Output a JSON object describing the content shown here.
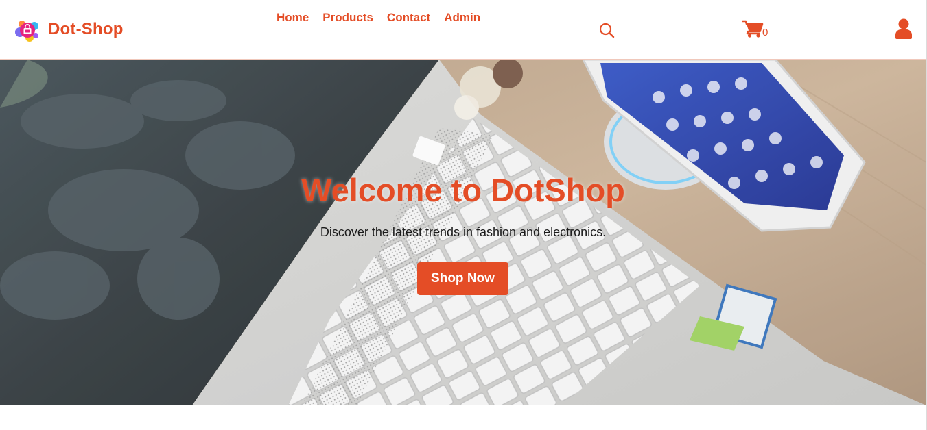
{
  "brand": {
    "name": "Dot-Shop",
    "icon": "shopping-bag-bubbles-icon",
    "color": "#e44d26"
  },
  "nav": {
    "items": [
      {
        "label": "Home"
      },
      {
        "label": "Products"
      },
      {
        "label": "Contact"
      },
      {
        "label": "Admin"
      }
    ]
  },
  "header": {
    "search_icon": "search-icon",
    "cart_icon": "shopping-cart-icon",
    "cart_count": "0",
    "user_icon": "user-icon"
  },
  "hero": {
    "title": "Welcome to DotShop",
    "subtitle": "Discover the latest trends in fashion and electronics.",
    "cta_label": "Shop Now",
    "background": "laptop-and-smartphone-on-desk-photo"
  },
  "colors": {
    "accent": "#e44d26",
    "text": "#1b1b1b",
    "background": "#ffffff"
  }
}
